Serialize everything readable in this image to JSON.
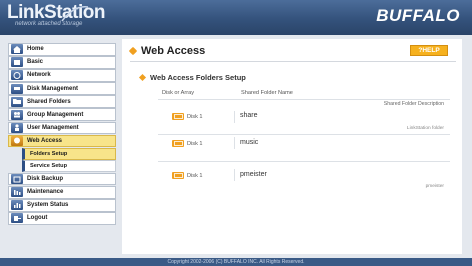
{
  "header": {
    "logo_title": "LinkStation",
    "logo_subtitle": "network attached storage",
    "brand": "BUFFALO"
  },
  "sidebar": {
    "items": [
      {
        "label": "Home",
        "icon": "home-icon"
      },
      {
        "label": "Basic",
        "icon": "basic-icon"
      },
      {
        "label": "Network",
        "icon": "network-icon"
      },
      {
        "label": "Disk Management",
        "icon": "disk-icon"
      },
      {
        "label": "Shared Folders",
        "icon": "folder-icon"
      },
      {
        "label": "Group Management",
        "icon": "group-icon"
      },
      {
        "label": "User Management",
        "icon": "user-icon"
      },
      {
        "label": "Web Access",
        "icon": "web-access-icon",
        "active": true
      },
      {
        "label": "Disk Backup",
        "icon": "backup-icon"
      },
      {
        "label": "Maintenance",
        "icon": "maintenance-icon"
      },
      {
        "label": "System Status",
        "icon": "status-icon"
      },
      {
        "label": "Logout",
        "icon": "logout-icon"
      }
    ],
    "sub_items": [
      {
        "label": "Folders Setup",
        "active": true
      },
      {
        "label": "Service Setup",
        "active": false
      }
    ]
  },
  "main": {
    "title": "Web Access",
    "help_label": "?HELP",
    "section_title": "Web Access Folders Setup",
    "col_disk": "Disk or Array",
    "col_name": "Shared Folder Name",
    "desc_heading": "Shared Folder Description",
    "rows": [
      {
        "disk": "Disk 1",
        "name": "share",
        "desc": "LinkStation folder"
      },
      {
        "disk": "Disk 1",
        "name": "music",
        "desc": ""
      },
      {
        "disk": "Disk 1",
        "name": "pmeister",
        "desc": "pmeister"
      }
    ]
  },
  "footer": {
    "copyright": "Copyright 2002-2006 (C) BUFFALO INC. All Rights Reserved."
  },
  "colors": {
    "header_blue": "#34527c",
    "accent_orange": "#f0a020",
    "active_yellow": "#f8e48a"
  }
}
